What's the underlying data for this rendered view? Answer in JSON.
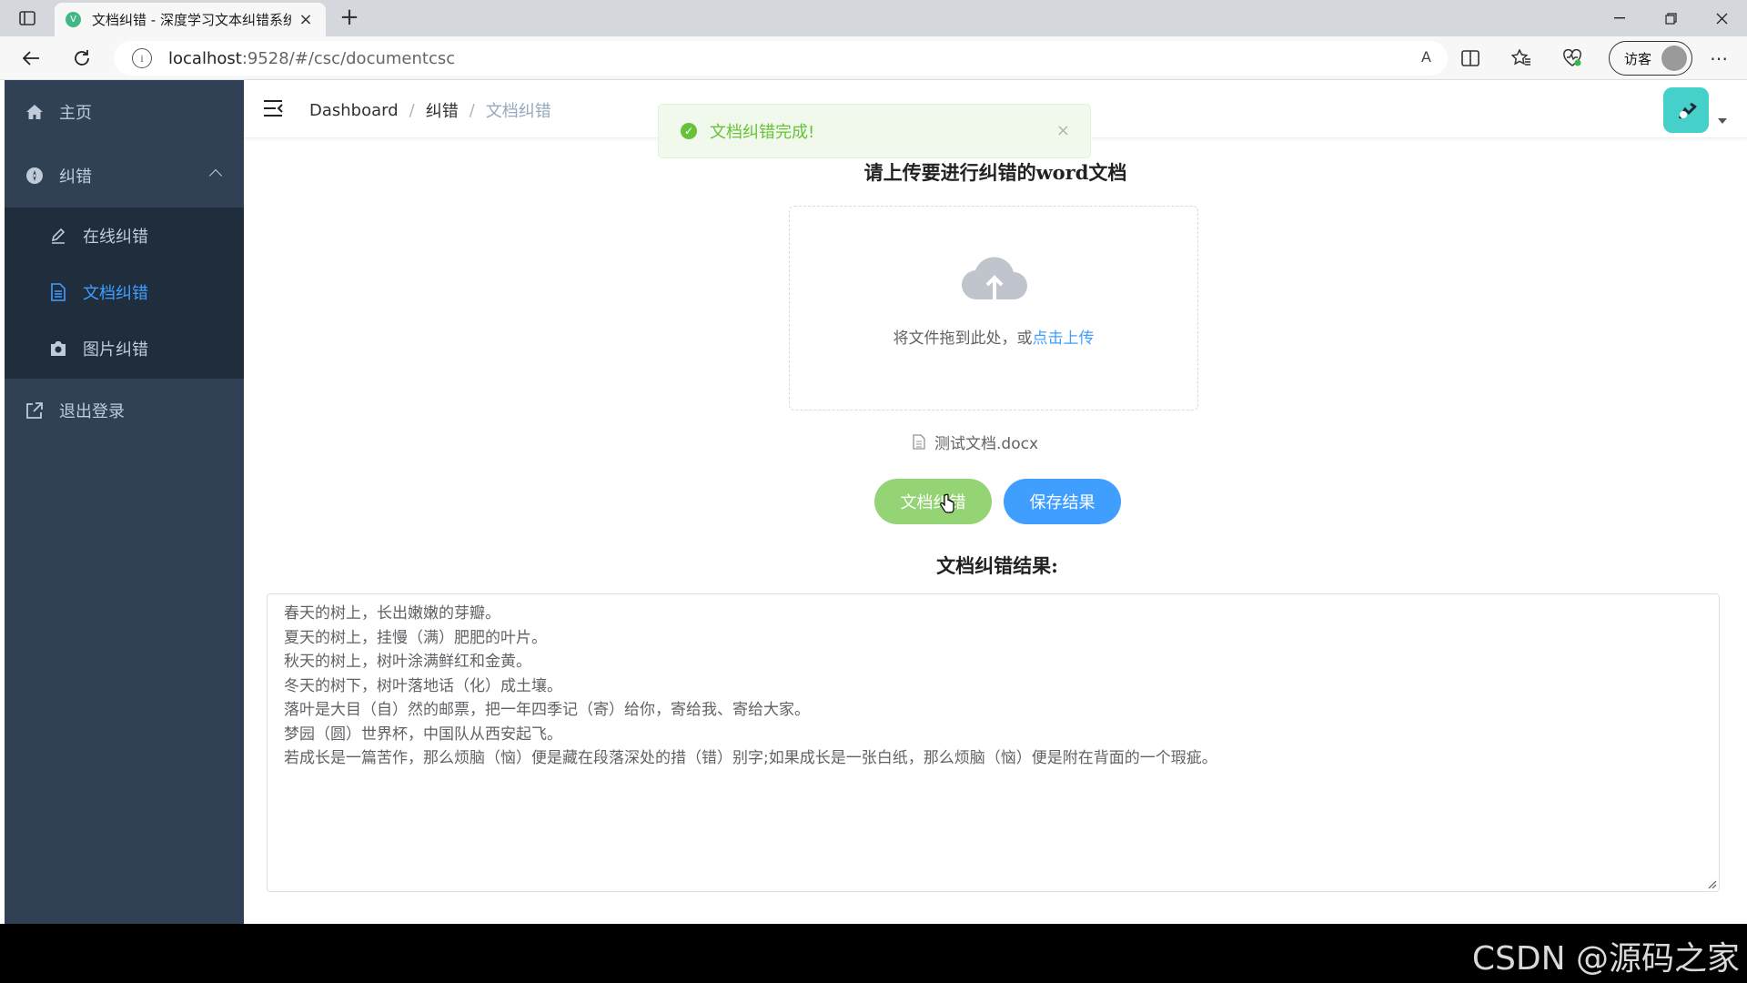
{
  "browser": {
    "tab_title": "文档纠错 - 深度学习文本纠错系统",
    "tab_favicon": "V",
    "url_host": "localhost",
    "url_path": ":9528/#/csc/documentcsc",
    "guest_label": "访客",
    "read_aloud": "A",
    "new_tab": "+"
  },
  "sidebar": {
    "home_label": "主页",
    "correct_label": "纠错",
    "sub_items": [
      {
        "label": "在线纠错",
        "icon": "pencil-icon"
      },
      {
        "label": "文档纠错",
        "icon": "document-icon",
        "active": true
      },
      {
        "label": "图片纠错",
        "icon": "camera-icon"
      }
    ],
    "logout_label": "退出登录"
  },
  "breadcrumb": [
    "Dashboard",
    "纠错",
    "文档纠错"
  ],
  "breadcrumb_sep": "/",
  "toast": {
    "message": "文档纠错完成!",
    "close": "×"
  },
  "upload": {
    "title": "请上传要进行纠错的word文档",
    "drop_text": "将文件拖到此处，或",
    "click_text": "点击上传",
    "file_name": "测试文档.docx"
  },
  "buttons": {
    "correct": "文档纠错",
    "save": "保存结果"
  },
  "result": {
    "title": "文档纠错结果:",
    "lines": [
      "春天的树上，长出嫩嫩的芽瓣。",
      "夏天的树上，挂慢（满）肥肥的叶片。",
      "秋天的树上，树叶涂满鲜红和金黄。",
      "冬天的树下，树叶落地话（化）成土壤。",
      "落叶是大目（自）然的邮票，把一年四季记（寄）给你，寄给我、寄给大家。",
      "梦园（圆）世界杯，中国队从西安起飞。",
      "若成长是一篇苦作，那么烦脑（恼）便是藏在段落深处的措（错）别字;如果成长是一张白纸，那么烦脑（恼）便是附在背面的一个瑕疵。"
    ]
  },
  "watermark": "CSDN @源码之家",
  "colors": {
    "sidebar": "#304156",
    "submenu": "#1f2d3d",
    "active": "#409eff",
    "success": "#67c23a",
    "green_button": "#95d475"
  }
}
